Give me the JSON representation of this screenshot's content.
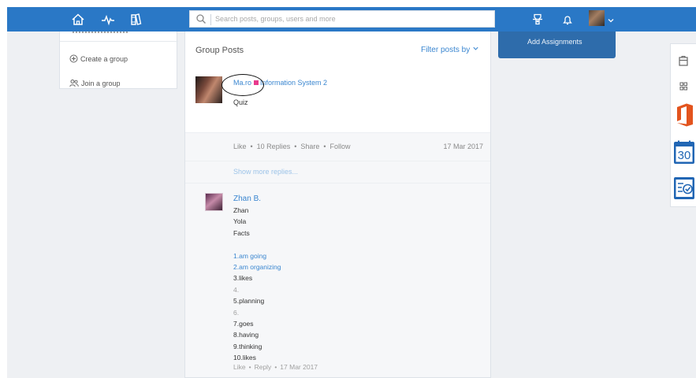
{
  "search": {
    "placeholder": "Search posts, groups, users and more"
  },
  "popover": {
    "label": "Add Assignments"
  },
  "sidebar": {
    "items": [
      {
        "label": "Create a group",
        "icon": "plus-circle-icon"
      },
      {
        "label": "Join a group",
        "icon": "users-icon"
      }
    ]
  },
  "feed": {
    "title": "Group Posts",
    "filter_label": "Filter posts by",
    "post": {
      "author": "Ma.ro",
      "group": "Information System 2",
      "body": "Quiz",
      "actions": [
        "Like",
        "10 Replies",
        "Share",
        "Follow"
      ],
      "date": "17 Mar 2017"
    },
    "show_more": "Show more replies...",
    "reply": {
      "author": "Zhan B.",
      "lines": [
        {
          "text": "Zhan",
          "style": "normal"
        },
        {
          "text": "Yola",
          "style": "normal"
        },
        {
          "text": "Facts",
          "style": "normal"
        },
        {
          "text": "",
          "style": "normal"
        },
        {
          "text": "1.am going",
          "style": "blue"
        },
        {
          "text": "2.am organizing",
          "style": "blue"
        },
        {
          "text": "3.likes",
          "style": "normal"
        },
        {
          "text": "4.",
          "style": "grey"
        },
        {
          "text": "5.planning",
          "style": "normal"
        },
        {
          "text": "6.",
          "style": "grey"
        },
        {
          "text": "7.goes",
          "style": "normal"
        },
        {
          "text": "8.having",
          "style": "normal"
        },
        {
          "text": "9.thinking",
          "style": "normal"
        },
        {
          "text": "10.likes",
          "style": "normal"
        }
      ],
      "actions": [
        "Like",
        "Reply"
      ],
      "date": "17 Mar 2017"
    }
  },
  "apps": [
    {
      "name": "store-icon"
    },
    {
      "name": "grid-icon"
    },
    {
      "name": "office-icon",
      "color": "#e3541e"
    },
    {
      "name": "calendar-icon",
      "label": "30",
      "color": "#2166b4"
    },
    {
      "name": "planner-icon",
      "color": "#2166b4"
    }
  ],
  "colors": {
    "topbar": "#2a78c6",
    "link": "#3a86d0",
    "tag": "#e83a8c"
  }
}
